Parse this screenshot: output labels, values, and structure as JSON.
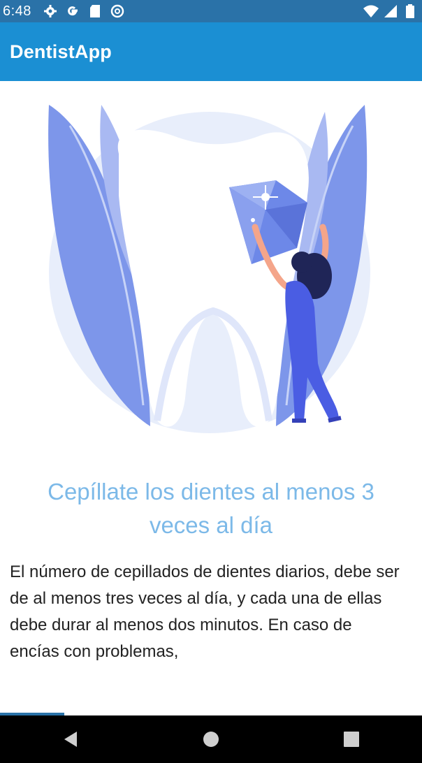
{
  "status_bar": {
    "time": "6:48",
    "icons_left": [
      "settings-icon",
      "google-icon",
      "sd-card-icon",
      "sync-icon"
    ],
    "icons_right": [
      "wifi-icon",
      "signal-icon",
      "battery-icon"
    ]
  },
  "app_bar": {
    "title": "DentistApp",
    "color": "#1b8fd3"
  },
  "content": {
    "illustration": "tooth-woman-diamond-illustration",
    "heading": "Cepíllate los dientes al menos 3 veces al día",
    "heading_color": "#7cb9e8",
    "body": "El número de cepillados de dientes diarios, debe ser de al menos tres veces al día, y cada una de ellas debe durar al menos dos minutos. En caso de encías con problemas,"
  },
  "nav_bar": {
    "buttons": [
      "back-icon",
      "home-icon",
      "recents-icon"
    ]
  }
}
